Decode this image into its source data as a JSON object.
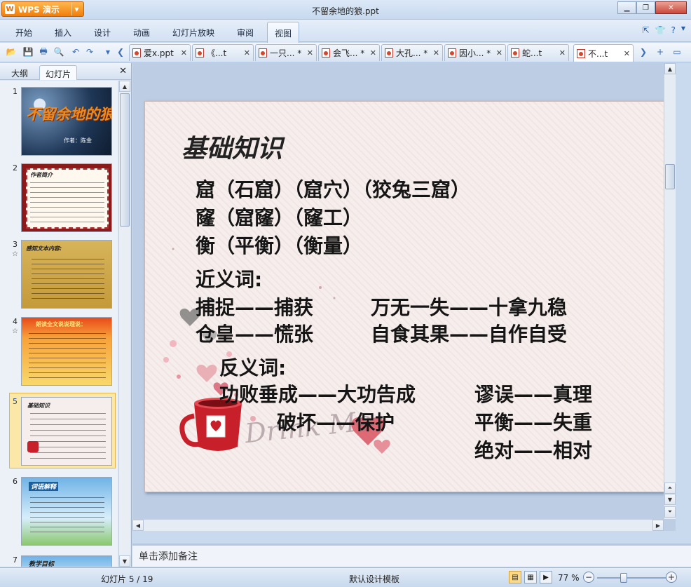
{
  "app": {
    "name": "WPS 演示",
    "window_title": "不留余地的狼.ppt"
  },
  "menu": {
    "items": [
      "开始",
      "插入",
      "设计",
      "动画",
      "幻灯片放映",
      "审阅",
      "视图"
    ],
    "active": "视图"
  },
  "doc_tabs": [
    {
      "label": "爱x.ppt"
    },
    {
      "label": "《...t"
    },
    {
      "label": "一只... *"
    },
    {
      "label": "会飞... *"
    },
    {
      "label": "大孔... *"
    },
    {
      "label": "因小... *"
    },
    {
      "label": "蛇...t"
    },
    {
      "label": "不...t",
      "active": true
    }
  ],
  "left_panel": {
    "tabs": [
      "大纲",
      "幻灯片"
    ],
    "active_tab": "幻灯片",
    "close_label": "✕",
    "thumbnails": [
      {
        "num": "1",
        "title": "不留余地的狼",
        "subtitle": "作者：陈金"
      },
      {
        "num": "2",
        "title": "作者简介"
      },
      {
        "num": "3",
        "title": "感知文本内容:",
        "star": "☆"
      },
      {
        "num": "4",
        "title": "朗读全文说说理说：",
        "star": "☆"
      },
      {
        "num": "5",
        "title": "基础知识",
        "selected": true
      },
      {
        "num": "6",
        "title": "词语解释"
      },
      {
        "num": "7",
        "title": "教学目标"
      }
    ]
  },
  "slide": {
    "title": "基础知识",
    "lines": [
      "窟（石窟）（窟穴）（狡兔三窟）",
      "窿（窟窿）（窿工）",
      "衡（平衡）（衡量）",
      "近义词:",
      "捕捉——捕获",
      "万无一失——十拿九稳",
      "仓皇——慌张",
      "自食其果——自作自受",
      "反义词:",
      "功败垂成——大功告成",
      "谬误——真理",
      "破坏——保护",
      "平衡——失重",
      "绝对——相对"
    ],
    "decoration_text": "Drink Me"
  },
  "notes": {
    "placeholder": "单击添加备注"
  },
  "status": {
    "slide_indicator": "幻灯片 5 / 19",
    "template": "默认设计模板",
    "zoom": "77 %",
    "zoom_level": 0.77
  },
  "colors": {
    "wps_orange": "#f07d0b",
    "selection": "#fbe7a8",
    "close_red": "#c9473a"
  }
}
